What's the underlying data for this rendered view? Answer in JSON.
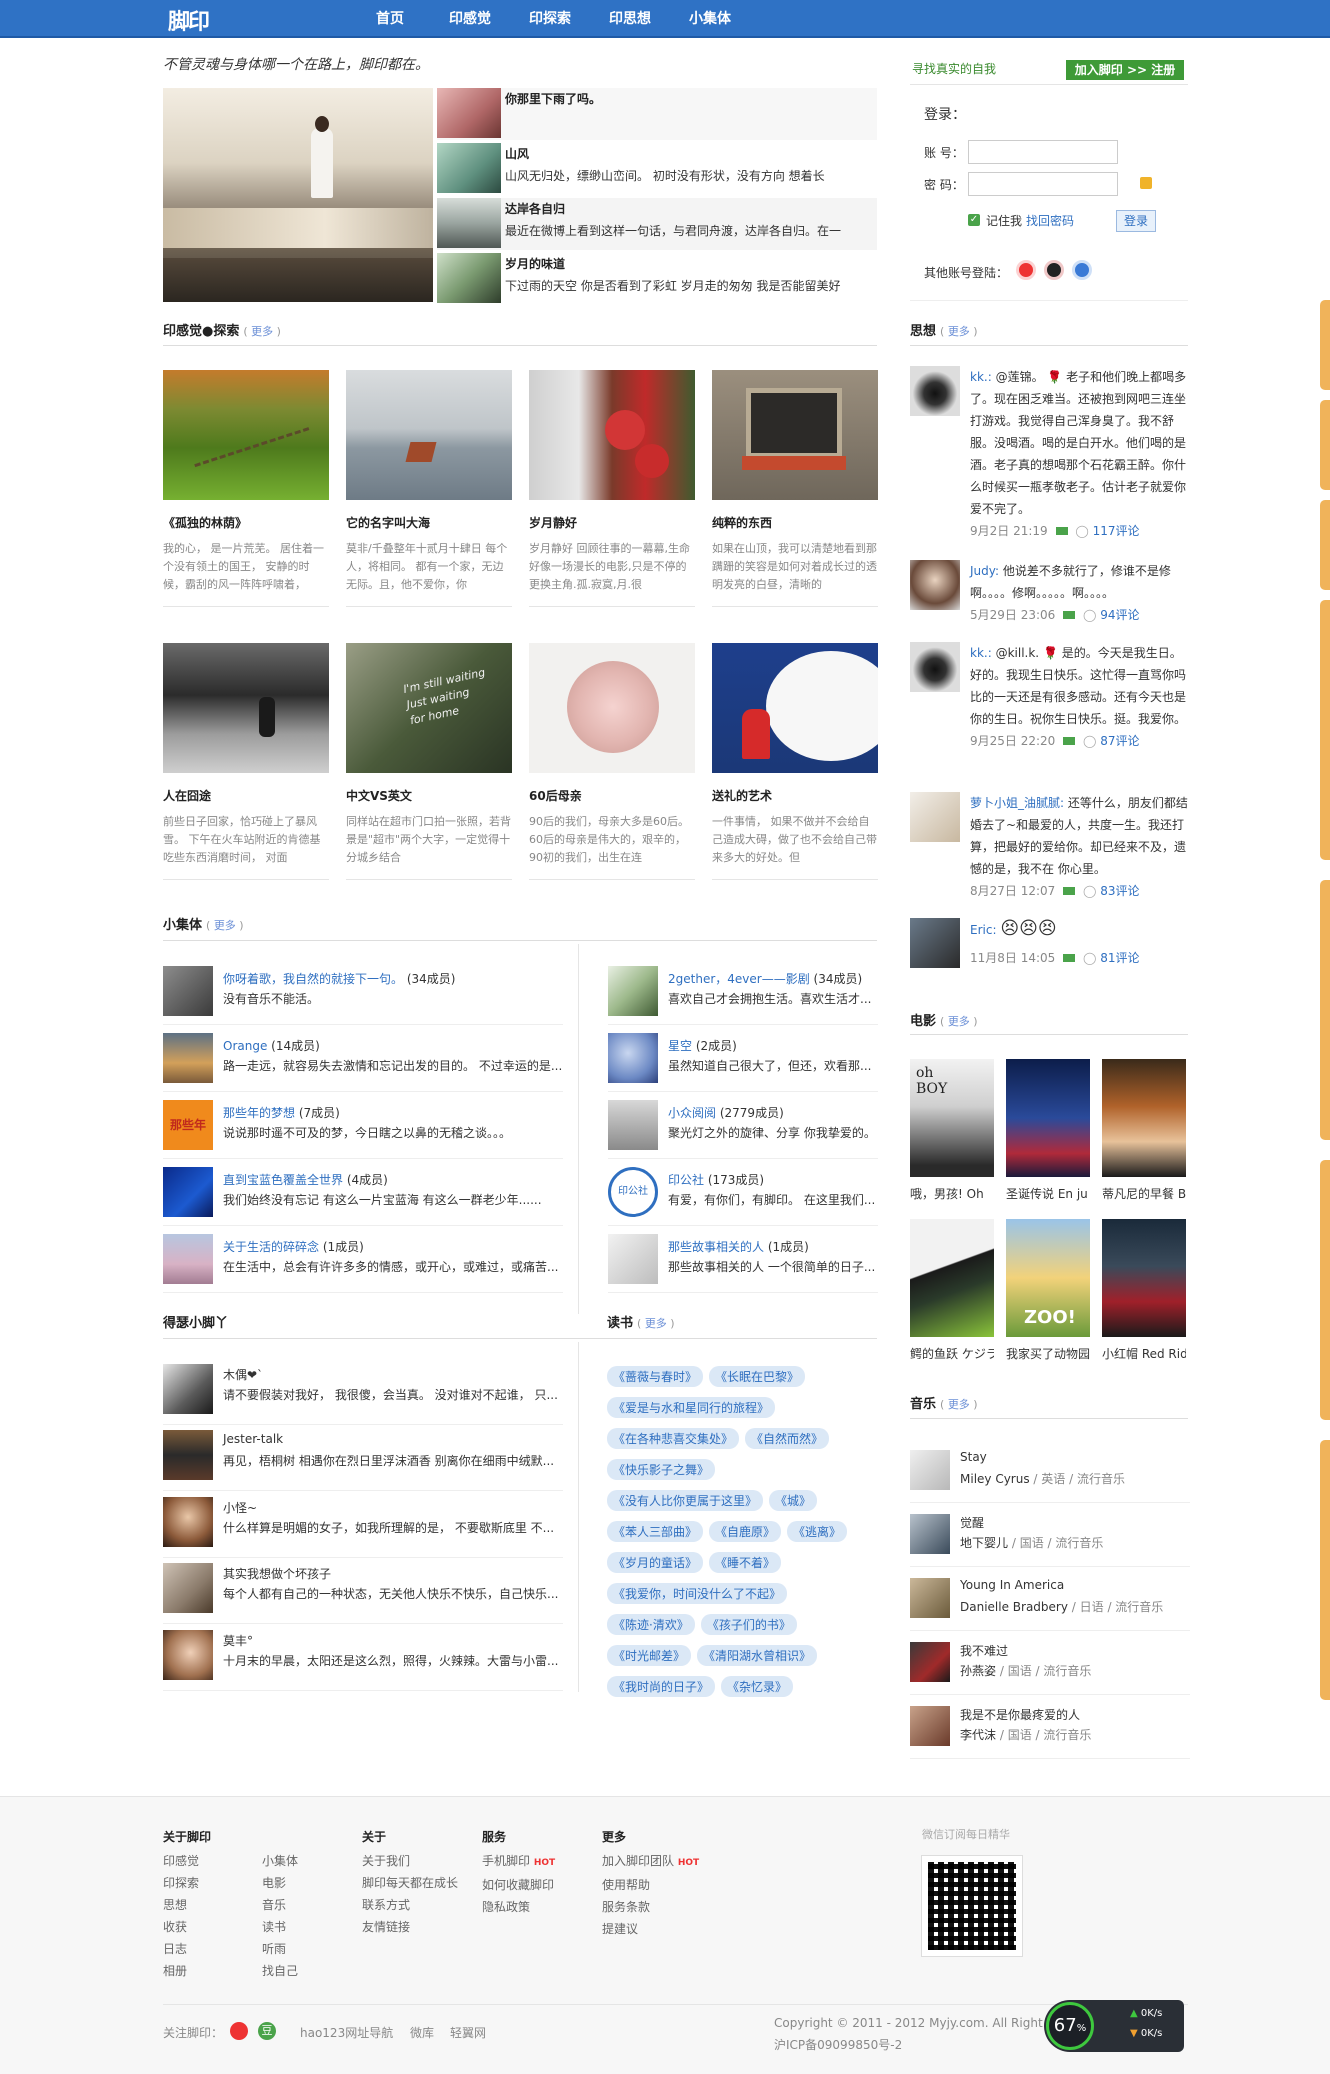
{
  "nav": {
    "logo": "脚印",
    "items": [
      "首页",
      "印感觉",
      "印探索",
      "印思想",
      "小集体"
    ]
  },
  "slogan": "不管灵魂与身体哪一个在路上，脚印都在。",
  "top_right": {
    "find": "寻找真实的自我",
    "join": "加入脚印 >> 注册"
  },
  "feature": [
    {
      "title": "你那里下雨了吗。",
      "desc": ""
    },
    {
      "title": "山风",
      "desc": "山风无归处，缥缈山峦间。 初时没有形状，没有方向 想着长"
    },
    {
      "title": "达岸各自归",
      "desc": "最近在微博上看到这样一句话，与君同舟渡，达岸各自归。在一"
    },
    {
      "title": "岁月的味道",
      "desc": "下过雨的天空 你是否看到了彩虹 岁月走的匆匆 我是否能留美好"
    }
  ],
  "login": {
    "title": "登录：",
    "account_label": "账 号：",
    "password_label": "密 码：",
    "remember": "记住我",
    "forgot": "找回密码",
    "submit": "登录",
    "other": "其他账号登陆："
  },
  "sections": {
    "feel": {
      "title": "印感觉●探索",
      "more": "更多"
    },
    "group": {
      "title": "小集体",
      "more": "更多"
    },
    "thought": {
      "title": "思想",
      "more": "更多"
    },
    "movie": {
      "title": "电影",
      "more": "更多"
    },
    "music": {
      "title": "音乐",
      "more": "更多"
    },
    "read": {
      "title": "读书",
      "more": "更多"
    },
    "feet": {
      "title": "得瑟小脚丫"
    }
  },
  "cards": [
    {
      "title": "《孤独的林荫》",
      "desc": "我的心， 是一片荒芜。 居住着一个没有领土的国王， 安静的时候，霸刮的风一阵阵呼啸着，"
    },
    {
      "title": "它的名字叫大海",
      "desc": "莫非/千叠整年十贰月十肆日 每个人，将相同。 都有一个家，无边无际。且，他不爱你，你"
    },
    {
      "title": "岁月静好",
      "desc": "岁月静好 回顾往事的一幕幕,生命好像一场漫长的电影,只是不停的更换主角.孤.寂寞,月.很"
    },
    {
      "title": "纯粹的东西",
      "desc": "如果在山顶，我可以清楚地看到那蹒跚的笑容是如何对着成长过的透明发亮的白昼，清晰的"
    },
    {
      "title": "人在囧途",
      "desc": "前些日子回家，恰巧碰上了暴风雪。 下午在火车站附近的肯德基吃些东西消磨时间， 对面"
    },
    {
      "title": "中文VS英文",
      "desc": "同样站在超市门口拍一张照，若背景是\"超市\"两个大字，一定觉得十分城乡结合"
    },
    {
      "title": "60后母亲",
      "desc": "90后的我们，母亲大多是60后。 60后的母亲是伟大的，艰辛的， 90初的我们，出生在连"
    },
    {
      "title": "送礼的艺术",
      "desc": "一件事情， 如果不做并不会给自己造成大碍，做了也不会给自己带来多大的好处。但"
    }
  ],
  "groups_left": [
    {
      "name": "你呀着歌，我自然的就接下一句。",
      "count": "(34成员)",
      "desc": "没有音乐不能活。"
    },
    {
      "name": "Orange",
      "count": "(14成员)",
      "desc": "路一走远，就容易失去激情和忘记出发的目的。 不过幸运的是..."
    },
    {
      "name": "那些年的梦想",
      "count": "(7成员)",
      "desc": "说说那时遥不可及的梦，今日瞎之以鼻的无稽之谈。。。"
    },
    {
      "name": "直到宝蓝色覆盖全世界",
      "count": "(4成员)",
      "desc": "我们始终没有忘记 有这么一片宝蓝海 有这么一群老少年......"
    },
    {
      "name": "关于生活的碎碎念",
      "count": "(1成员)",
      "desc": "在生活中，总会有许许多多的情感，或开心，或难过，或痛苦..."
    }
  ],
  "groups_right": [
    {
      "name": "2gether，4ever——影剧",
      "count": "(34成员)",
      "desc": "喜欢自己才会拥抱生活。喜欢生活才..."
    },
    {
      "name": "星空",
      "count": "(2成员)",
      "desc": "虽然知道自己很大了，但还，欢看那..."
    },
    {
      "name": "小众阅阅",
      "count": "(2779成员)",
      "desc": "聚光灯之外的旋律、分享 你我挚爱的。"
    },
    {
      "name": "印公社",
      "count": "(173成员)",
      "desc": "有爱，有你们，有脚印。 在这里我们..."
    },
    {
      "name": "那些故事相关的人",
      "count": "(1成员)",
      "desc": "那些故事相关的人 一个很简单的日子..."
    }
  ],
  "feet": [
    {
      "name": "木偶❤︎`",
      "desc": "请不要假装对我好， 我很傻，会当真。 没对谁对不起谁， 只..."
    },
    {
      "name": "Jester-talk",
      "desc": "再见，梧桐树 相遇你在烈日里浮沫酒香 别离你在细雨中绒默..."
    },
    {
      "name": "小怪~",
      "desc": "什么样算是明媚的女子，如我所理解的是， 不要歇斯底里 不..."
    },
    {
      "name": "其实我想做个坏孩子",
      "desc": "每个人都有自己的一种状态，无关他人快乐不快乐，自己快乐..."
    },
    {
      "name": "莫丰°",
      "desc": "十月末的早晨，太阳还是这么烈，照得，火辣辣。大雷与小雷..."
    }
  ],
  "tags": [
    [
      "《蔷薇与春时》",
      "《长眠在巴黎》"
    ],
    [
      "《爱是与水和星同行的旅程》"
    ],
    [
      "《在各种悲喜交集处》",
      "《自然而然》"
    ],
    [
      "《快乐影子之舞》"
    ],
    [
      "《没有人比你更属于这里》",
      "《城》"
    ],
    [
      "《苯人三部曲》",
      "《自鹿原》",
      "《逃离》"
    ],
    [
      "《岁月的童话》",
      "《睡不着》"
    ],
    [
      "《我爱你，时间没什么了不起》"
    ],
    [
      "《陈迹·清欢》",
      "《孩子们的书》"
    ],
    [
      "《时光邮差》",
      "《清阳湖水曾相识》"
    ],
    [
      "《我时尚的日子》",
      "《杂忆录》"
    ]
  ],
  "thoughts": [
    {
      "name": "kk.:",
      "text": "@莲锦。 🌹 老子和他们晚上都喝多了。现在困乏难当。还被抱到网吧三连坐打游戏。我觉得自己浑身臭了。我不舒服。没喝酒。喝的是白开水。他们喝的是酒。老子真的想喝那个石花霸王醉。你什么时候买一瓶孝敬老子。估计老子就爱你爱不完了。",
      "date": "9月2日 21:19",
      "comments": "117评论"
    },
    {
      "name": "Judy:",
      "text": "他说差不多就行了，修谁不是修啊。。。。修啊。。。。。啊。。。。",
      "date": "5月29日 23:06",
      "comments": "94评论"
    },
    {
      "name": "kk.:",
      "text": "@kill.k. 🌹 是的。今天是我生日。好的。我现生日快乐。这忙得一直骂你吗比的一天还是有很多感动。还有今天也是你的生日。祝你生日快乐。挺。我爱你。",
      "date": "9月25日 22:20",
      "comments": "87评论"
    },
    {
      "name": "萝卜小姐_油腻腻:",
      "text": "还等什么，朋友们都结婚去了~和最爱的人，共度一生。我还打算，把最好的爱给你。却已经来不及，遗憾的是，我不在 你心里。",
      "date": "8月27日 12:07",
      "comments": "83评论"
    },
    {
      "name": "Eric:",
      "text": "😣😣😣",
      "date": "11月8日 14:05",
      "comments": "81评论"
    }
  ],
  "movies": [
    {
      "title": "哦，男孩! Oh"
    },
    {
      "title": "圣诞传说 En ju"
    },
    {
      "title": "蒂凡尼的早餐 B"
    },
    {
      "title": "鳄的鱼跃 ケジラ"
    },
    {
      "title": "我家买了动物园"
    },
    {
      "title": "小红帽 Red Rid"
    }
  ],
  "music": [
    {
      "title": "Stay",
      "artist": "Miley Cyrus",
      "meta": "/ 英语 / 流行音乐"
    },
    {
      "title": "觉醒",
      "artist": "地下婴儿",
      "meta": "/ 国语 / 流行音乐"
    },
    {
      "title": "Young In America",
      "artist": "Danielle Bradbery",
      "meta": "/ 日语 / 流行音乐"
    },
    {
      "title": "我不难过",
      "artist": "孙燕姿",
      "meta": "/ 国语 / 流行音乐"
    },
    {
      "title": "我是不是你最疼爱的人",
      "artist": "李代沫",
      "meta": "/ 国语 / 流行音乐"
    }
  ],
  "footer": {
    "col1": {
      "h": "关于脚印",
      "a": [
        "印感觉",
        "印探索",
        "思想",
        "收获",
        "日志",
        "相册"
      ],
      "b": [
        "小集体",
        "电影",
        "音乐",
        "读书",
        "听雨",
        "找自己"
      ]
    },
    "col2": {
      "h": "关于",
      "a": [
        "关于我们",
        "脚印每天都在成长",
        "联系方式",
        "友情链接"
      ]
    },
    "col3": {
      "h": "服务",
      "a": [
        "手机脚印",
        "如何收藏脚印",
        "隐私政策"
      ]
    },
    "col4": {
      "h": "更多",
      "a": [
        "加入脚印团队",
        "使用帮助",
        "服务条款",
        "提建议"
      ]
    },
    "qr_title": "微信订阅每日精华",
    "follow": "关注脚印：",
    "links": [
      "hao123网址导航",
      "微库",
      "轻翼网"
    ],
    "copyright": "Copyright © 2011 - 2012 Myjy.com. All Right",
    "icp": "沪ICP备09099850号-2",
    "hot": "HOT"
  },
  "speed": {
    "percent": "67",
    "pct_sign": "%",
    "up": "0K/s",
    "down": "0K/s"
  }
}
